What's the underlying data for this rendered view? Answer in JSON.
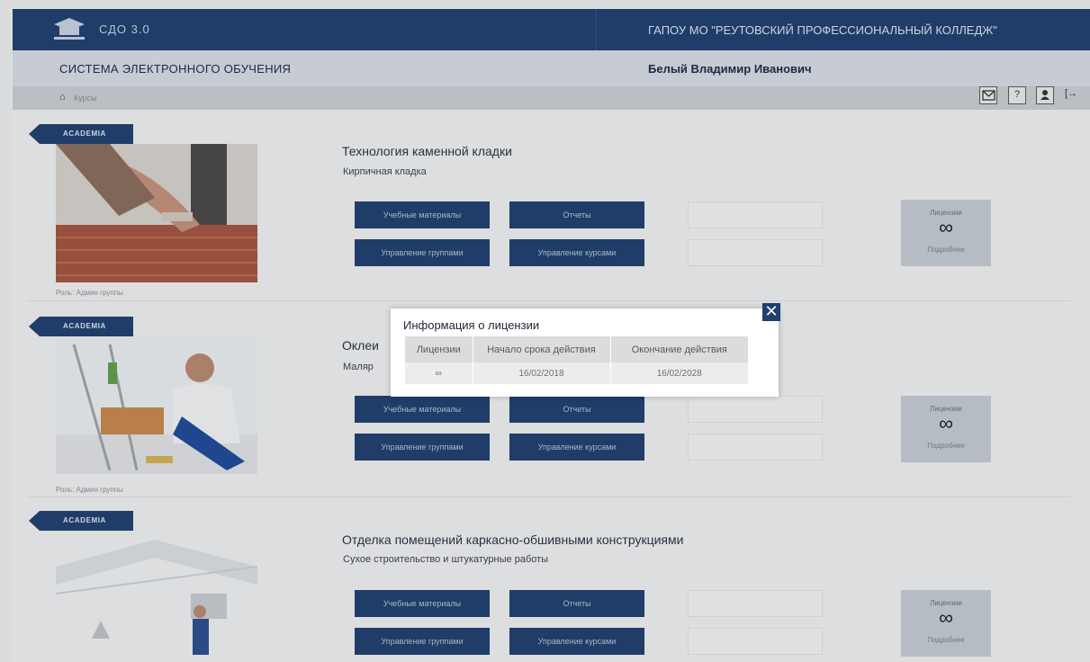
{
  "header": {
    "system_short": "СДО 3.0",
    "organization": "ГАПОУ МО \"РЕУТОВСКИЙ ПРОФЕССИОНАЛЬНЫЙ КОЛЛЕДЖ\""
  },
  "subheader": {
    "system_name": "СИСТЕМА ЭЛЕКТРОННОГО ОБУЧЕНИЯ",
    "user_name": "Белый Владимир Иванович"
  },
  "breadcrumb": {
    "home_icon": "home-icon",
    "current": "Курсы"
  },
  "toolbar": {
    "icons": [
      "mail-icon",
      "help-icon",
      "user-icon",
      "logout-icon"
    ],
    "help_glyph": "?",
    "logout_glyph": "[→"
  },
  "courses": [
    {
      "ribbon": "ACADEMIA",
      "title": "Технология каменной кладки",
      "subtitle": "Кирпичная кладка",
      "caption": "Роль: Админ группы",
      "btn_materials": "Учебные материалы",
      "btn_reports": "Отчеты",
      "btn_groups": "Управление группами",
      "btn_courses": "Управление курсами",
      "license_label": "Лицензии",
      "license_value": "∞",
      "license_more": "Подробнее"
    },
    {
      "ribbon": "ACADEMIA",
      "title": "Оклеи",
      "subtitle": "Маляр",
      "caption": "Роль: Админ группы",
      "btn_materials": "Учебные материалы",
      "btn_reports": "Отчеты",
      "btn_groups": "Управление группами",
      "btn_courses": "Управление курсами",
      "license_label": "Лицензии",
      "license_value": "∞",
      "license_more": "Подробнее"
    },
    {
      "ribbon": "ACADEMIA",
      "title": "Отделка помещений каркасно-обшивными конструкциями",
      "subtitle": "Сухое строительство и штукатурные работы",
      "caption": "",
      "btn_materials": "Учебные материалы",
      "btn_reports": "Отчеты",
      "btn_groups": "Управление группами",
      "btn_courses": "Управление курсами",
      "license_label": "Лицензии",
      "license_value": "∞",
      "license_more": "Подробнее"
    }
  ],
  "modal": {
    "title": "Информация о лицензии",
    "close_icon": "close-icon",
    "close_glyph": "✕",
    "columns": [
      "Лицензии",
      "Начало срока действия",
      "Окончание действия"
    ],
    "rows": [
      [
        "∞",
        "16/02/2018",
        "16/02/2028"
      ]
    ]
  },
  "colors": {
    "primary": "#1f3f6e",
    "subheader": "#d8dde6",
    "breadcrumb_bar": "#cccfd3",
    "license_box": "#c7ccd3"
  }
}
